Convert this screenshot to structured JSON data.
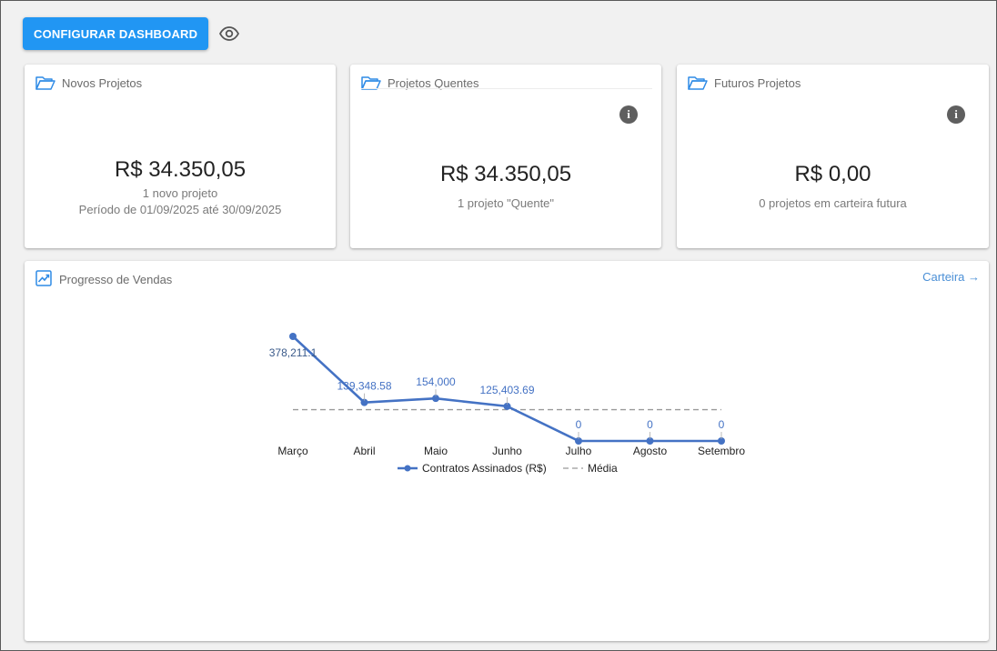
{
  "toolbar": {
    "configure_label": "CONFIGURAR DASHBOARD",
    "visibility_icon": "eye-icon"
  },
  "cards": [
    {
      "title": "Novos Projetos",
      "icon": "folder-open-icon",
      "amount": "R$ 34.350,05",
      "line1": "1 novo projeto",
      "line2": "Período de 01/09/2025 até 30/09/2025"
    },
    {
      "title": "Projetos Quentes",
      "icon": "folder-open-icon",
      "amount": "R$ 34.350,05",
      "line1": "1 projeto \"Quente\"",
      "info_icon": "info-icon"
    },
    {
      "title": "Futuros Projetos",
      "icon": "folder-open-icon",
      "amount": "R$ 0,00",
      "line1": "0 projetos em carteira futura",
      "info_icon": "info-icon"
    }
  ],
  "sales": {
    "title": "Progresso de Vendas",
    "icon": "trending-up-icon",
    "link_label": "Carteira →"
  },
  "chart_data": {
    "type": "line",
    "categories": [
      "Março",
      "Abril",
      "Maio",
      "Junho",
      "Julho",
      "Agosto",
      "Setembro"
    ],
    "series": [
      {
        "name": "Contratos Assinados (R$)",
        "color": "#4472c4",
        "values": [
          378211.1,
          139348.58,
          154000,
          125403.69,
          0,
          0,
          0
        ],
        "labels": [
          "378,211.1",
          "139,348.58",
          "154,000",
          "125,403.69",
          "0",
          "0",
          "0"
        ]
      },
      {
        "name": "Média",
        "style": "dashed",
        "color": "#999999",
        "values": [
          113280.48,
          113280.48,
          113280.48,
          113280.48,
          113280.48,
          113280.48,
          113280.48
        ]
      }
    ],
    "ylim": [
      0,
      378211.1
    ],
    "grid": false,
    "legend": "bottom"
  }
}
